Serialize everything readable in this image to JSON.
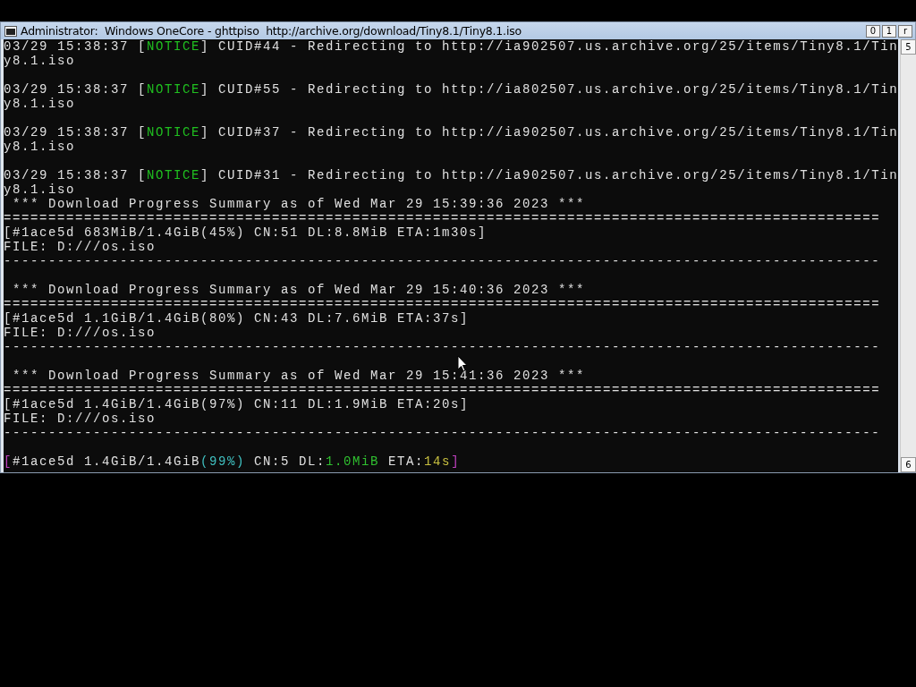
{
  "window": {
    "title": "Administrator:  Windows OneCore - ghttpiso  http://archive.org/download/Tiny8.1/Tiny8.1.iso",
    "buttons": [
      "0",
      "1",
      "r"
    ]
  },
  "scrollbar": {
    "up": "5",
    "down": "6"
  },
  "lines": [
    {
      "kind": "text",
      "segments": [
        {
          "text": "03/29 15:38:37 ["
        },
        {
          "text": "NOTICE",
          "color": "#20c020"
        },
        {
          "text": "] CUID#44 - Redirecting to http://ia902507.us.archive.org/25/items/Tiny8.1/Tin"
        }
      ]
    },
    {
      "kind": "text",
      "segments": [
        {
          "text": "y8.1.iso"
        }
      ]
    },
    {
      "kind": "blank"
    },
    {
      "kind": "text",
      "segments": [
        {
          "text": "03/29 15:38:37 ["
        },
        {
          "text": "NOTICE",
          "color": "#20c020"
        },
        {
          "text": "] CUID#55 - Redirecting to http://ia802507.us.archive.org/25/items/Tiny8.1/Tin"
        }
      ]
    },
    {
      "kind": "text",
      "segments": [
        {
          "text": "y8.1.iso"
        }
      ]
    },
    {
      "kind": "blank"
    },
    {
      "kind": "text",
      "segments": [
        {
          "text": "03/29 15:38:37 ["
        },
        {
          "text": "NOTICE",
          "color": "#20c020"
        },
        {
          "text": "] CUID#37 - Redirecting to http://ia902507.us.archive.org/25/items/Tiny8.1/Tin"
        }
      ]
    },
    {
      "kind": "text",
      "segments": [
        {
          "text": "y8.1.iso"
        }
      ]
    },
    {
      "kind": "blank"
    },
    {
      "kind": "text",
      "segments": [
        {
          "text": "03/29 15:38:37 ["
        },
        {
          "text": "NOTICE",
          "color": "#20c020"
        },
        {
          "text": "] CUID#31 - Redirecting to http://ia902507.us.archive.org/25/items/Tiny8.1/Tin"
        }
      ]
    },
    {
      "kind": "text",
      "segments": [
        {
          "text": "y8.1.iso"
        }
      ]
    },
    {
      "kind": "text",
      "segments": [
        {
          "text": " *** Download Progress Summary as of Wed Mar 29 15:39:36 2023 ***"
        }
      ]
    },
    {
      "kind": "text",
      "segments": [
        {
          "text": "=================================================================================================="
        }
      ]
    },
    {
      "kind": "text",
      "segments": [
        {
          "text": "[#1ace5d 683MiB/1.4GiB(45%) CN:51 DL:8.8MiB ETA:1m30s]"
        }
      ]
    },
    {
      "kind": "text",
      "segments": [
        {
          "text": "FILE: D:///os.iso"
        }
      ]
    },
    {
      "kind": "text",
      "segments": [
        {
          "text": "--------------------------------------------------------------------------------------------------"
        }
      ]
    },
    {
      "kind": "blank"
    },
    {
      "kind": "text",
      "segments": [
        {
          "text": " *** Download Progress Summary as of Wed Mar 29 15:40:36 2023 ***"
        }
      ]
    },
    {
      "kind": "text",
      "segments": [
        {
          "text": "=================================================================================================="
        }
      ]
    },
    {
      "kind": "text",
      "segments": [
        {
          "text": "[#1ace5d 1.1GiB/1.4GiB(80%) CN:43 DL:7.6MiB ETA:37s]"
        }
      ]
    },
    {
      "kind": "text",
      "segments": [
        {
          "text": "FILE: D:///os.iso"
        }
      ]
    },
    {
      "kind": "text",
      "segments": [
        {
          "text": "--------------------------------------------------------------------------------------------------"
        }
      ]
    },
    {
      "kind": "blank"
    },
    {
      "kind": "text",
      "segments": [
        {
          "text": " *** Download Progress Summary as of Wed Mar 29 15:41:36 2023 ***"
        }
      ]
    },
    {
      "kind": "text",
      "segments": [
        {
          "text": "=================================================================================================="
        }
      ]
    },
    {
      "kind": "text",
      "segments": [
        {
          "text": "[#1ace5d 1.4GiB/1.4GiB(97%) CN:11 DL:1.9MiB ETA:20s]"
        }
      ]
    },
    {
      "kind": "text",
      "segments": [
        {
          "text": "FILE: D:///os.iso"
        }
      ]
    },
    {
      "kind": "text",
      "segments": [
        {
          "text": "--------------------------------------------------------------------------------------------------"
        }
      ]
    },
    {
      "kind": "blank"
    },
    {
      "kind": "text",
      "segments": [
        {
          "text": "[",
          "color": "#c040c0"
        },
        {
          "text": "#1ace5d 1.4GiB/1.4GiB"
        },
        {
          "text": "(99%)",
          "color": "#40c0c0"
        },
        {
          "text": " CN:5 DL:"
        },
        {
          "text": "1.0MiB",
          "color": "#30c030"
        },
        {
          "text": " ETA:"
        },
        {
          "text": "14s",
          "color": "#c8c040"
        },
        {
          "text": "]",
          "color": "#c040c0"
        }
      ]
    }
  ]
}
